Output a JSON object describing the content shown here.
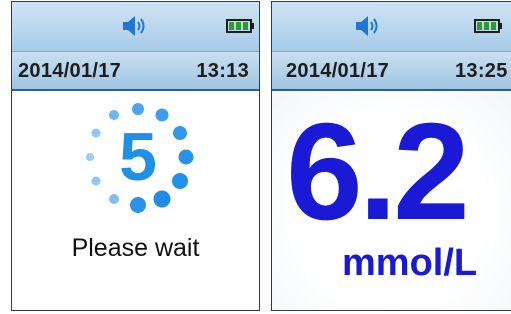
{
  "left_screen": {
    "date": "2014/01/17",
    "time": "13:13",
    "countdown": "5",
    "message": "Please wait",
    "icons": {
      "sound": "speaker-icon",
      "battery": "battery-icon"
    }
  },
  "right_screen": {
    "date": "2014/01/17",
    "time": "13:25",
    "reading": "6.2",
    "unit": "mmol/L",
    "icons": {
      "sound": "speaker-icon",
      "battery": "battery-icon"
    }
  },
  "colors": {
    "accent_blue": "#1e90e6",
    "reading_blue": "#1a1ad6",
    "bar_blue": "#a7cbe8",
    "battery_green": "#2e9b2e"
  }
}
